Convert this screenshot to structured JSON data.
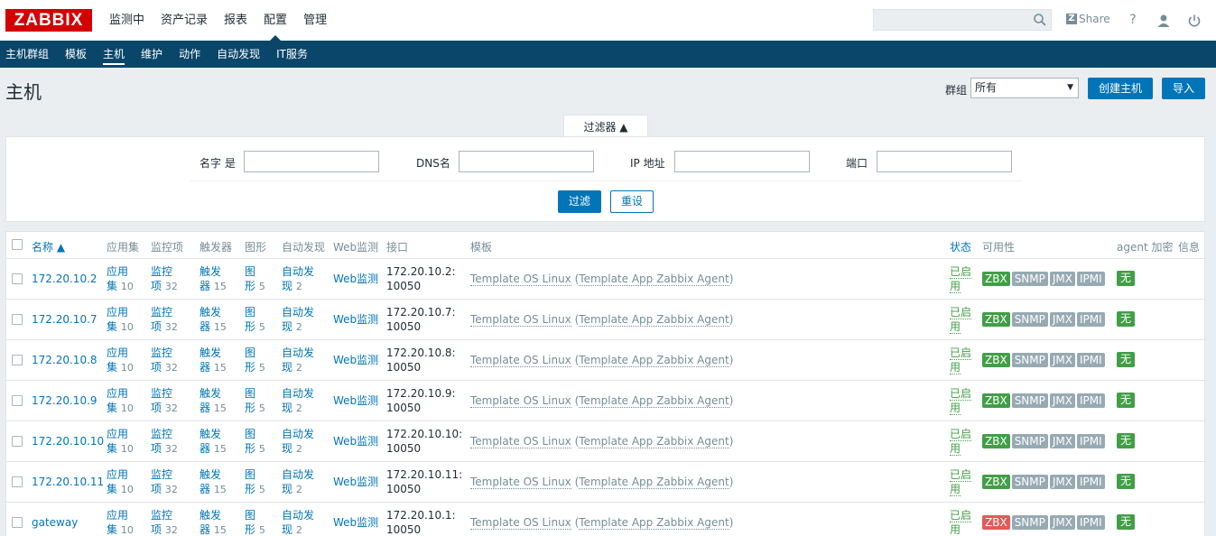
{
  "app": {
    "logo": "ZABBIX",
    "main_nav": [
      "监测中",
      "资产记录",
      "报表",
      "配置",
      "管理"
    ],
    "main_nav_active": "配置",
    "share_label": "Share",
    "help_label": "?"
  },
  "sub_nav": [
    "主机群组",
    "模板",
    "主机",
    "维护",
    "动作",
    "自动发现",
    "IT服务"
  ],
  "sub_nav_active": "主机",
  "page": {
    "title": "主机",
    "group_label": "群组",
    "group_value": "所有",
    "create_button": "创建主机",
    "import_button": "导入"
  },
  "filter": {
    "tab_label": "过滤器 ▲",
    "name_label": "名字 是",
    "dns_label": "DNS名",
    "ip_label": "IP 地址",
    "port_label": "端口",
    "name_value": "",
    "dns_value": "",
    "ip_value": "",
    "port_value": "",
    "apply_button": "过滤",
    "reset_button": "重设"
  },
  "table": {
    "headers": {
      "name": "名称 ▲",
      "applications": "应用集",
      "items": "监控项",
      "triggers": "触发器",
      "graphs": "图形",
      "discovery": "自动发现",
      "web": "Web监测",
      "interface": "接口",
      "templates": "模板",
      "status": "状态",
      "availability": "可用性",
      "agent_encryption": "agent 加密",
      "info": "信息"
    },
    "rows": [
      {
        "name": "172.20.10.2",
        "app_a": "应用",
        "app_b": "集",
        "app_count": "10",
        "item_a": "监控",
        "item_b": "项",
        "item_count": "32",
        "trig_a": "触发",
        "trig_b": "器",
        "trig_count": "15",
        "graph_a": "图",
        "graph_b": "形",
        "graph_count": "5",
        "disc_a": "自动发",
        "disc_b": "现",
        "disc_count": "2",
        "web": "Web监测",
        "iface_a": "172.20.10.2:",
        "iface_b": "10050",
        "tpl_a": "Template OS Linux",
        "tpl_b": "Template App Zabbix Agent",
        "status_a": "已启",
        "status_b": "用",
        "zbx": "ZBX",
        "snmp": "SNMP",
        "jmx": "JMX",
        "ipmi": "IPMI",
        "zbx_state": "ok",
        "enc": "无"
      },
      {
        "name": "172.20.10.7",
        "app_a": "应用",
        "app_b": "集",
        "app_count": "10",
        "item_a": "监控",
        "item_b": "项",
        "item_count": "32",
        "trig_a": "触发",
        "trig_b": "器",
        "trig_count": "15",
        "graph_a": "图",
        "graph_b": "形",
        "graph_count": "5",
        "disc_a": "自动发",
        "disc_b": "现",
        "disc_count": "2",
        "web": "Web监测",
        "iface_a": "172.20.10.7:",
        "iface_b": "10050",
        "tpl_a": "Template OS Linux",
        "tpl_b": "Template App Zabbix Agent",
        "status_a": "已启",
        "status_b": "用",
        "zbx": "ZBX",
        "snmp": "SNMP",
        "jmx": "JMX",
        "ipmi": "IPMI",
        "zbx_state": "ok",
        "enc": "无"
      },
      {
        "name": "172.20.10.8",
        "app_a": "应用",
        "app_b": "集",
        "app_count": "10",
        "item_a": "监控",
        "item_b": "项",
        "item_count": "32",
        "trig_a": "触发",
        "trig_b": "器",
        "trig_count": "15",
        "graph_a": "图",
        "graph_b": "形",
        "graph_count": "5",
        "disc_a": "自动发",
        "disc_b": "现",
        "disc_count": "2",
        "web": "Web监测",
        "iface_a": "172.20.10.8:",
        "iface_b": "10050",
        "tpl_a": "Template OS Linux",
        "tpl_b": "Template App Zabbix Agent",
        "status_a": "已启",
        "status_b": "用",
        "zbx": "ZBX",
        "snmp": "SNMP",
        "jmx": "JMX",
        "ipmi": "IPMI",
        "zbx_state": "ok",
        "enc": "无"
      },
      {
        "name": "172.20.10.9",
        "app_a": "应用",
        "app_b": "集",
        "app_count": "10",
        "item_a": "监控",
        "item_b": "项",
        "item_count": "32",
        "trig_a": "触发",
        "trig_b": "器",
        "trig_count": "15",
        "graph_a": "图",
        "graph_b": "形",
        "graph_count": "5",
        "disc_a": "自动发",
        "disc_b": "现",
        "disc_count": "2",
        "web": "Web监测",
        "iface_a": "172.20.10.9:",
        "iface_b": "10050",
        "tpl_a": "Template OS Linux",
        "tpl_b": "Template App Zabbix Agent",
        "status_a": "已启",
        "status_b": "用",
        "zbx": "ZBX",
        "snmp": "SNMP",
        "jmx": "JMX",
        "ipmi": "IPMI",
        "zbx_state": "ok",
        "enc": "无"
      },
      {
        "name": "172.20.10.10",
        "app_a": "应用",
        "app_b": "集",
        "app_count": "10",
        "item_a": "监控",
        "item_b": "项",
        "item_count": "32",
        "trig_a": "触发",
        "trig_b": "器",
        "trig_count": "15",
        "graph_a": "图",
        "graph_b": "形",
        "graph_count": "5",
        "disc_a": "自动发",
        "disc_b": "现",
        "disc_count": "2",
        "web": "Web监测",
        "iface_a": "172.20.10.10:",
        "iface_b": "10050",
        "tpl_a": "Template OS Linux",
        "tpl_b": "Template App Zabbix Agent",
        "status_a": "已启",
        "status_b": "用",
        "zbx": "ZBX",
        "snmp": "SNMP",
        "jmx": "JMX",
        "ipmi": "IPMI",
        "zbx_state": "ok",
        "enc": "无"
      },
      {
        "name": "172.20.10.11",
        "app_a": "应用",
        "app_b": "集",
        "app_count": "10",
        "item_a": "监控",
        "item_b": "项",
        "item_count": "32",
        "trig_a": "触发",
        "trig_b": "器",
        "trig_count": "15",
        "graph_a": "图",
        "graph_b": "形",
        "graph_count": "5",
        "disc_a": "自动发",
        "disc_b": "现",
        "disc_count": "2",
        "web": "Web监测",
        "iface_a": "172.20.10.11:",
        "iface_b": "10050",
        "tpl_a": "Template OS Linux",
        "tpl_b": "Template App Zabbix Agent",
        "status_a": "已启",
        "status_b": "用",
        "zbx": "ZBX",
        "snmp": "SNMP",
        "jmx": "JMX",
        "ipmi": "IPMI",
        "zbx_state": "ok",
        "enc": "无"
      },
      {
        "name": "gateway",
        "app_a": "应用",
        "app_b": "集",
        "app_count": "10",
        "item_a": "监控",
        "item_b": "项",
        "item_count": "32",
        "trig_a": "触发",
        "trig_b": "器",
        "trig_count": "15",
        "graph_a": "图",
        "graph_b": "形",
        "graph_count": "5",
        "disc_a": "自动发",
        "disc_b": "现",
        "disc_count": "2",
        "web": "Web监测",
        "iface_a": "172.20.10.1:",
        "iface_b": "10050",
        "tpl_a": "Template OS Linux",
        "tpl_b": "Template App Zabbix Agent",
        "status_a": "已启",
        "status_b": "用",
        "zbx": "ZBX",
        "snmp": "SNMP",
        "jmx": "JMX",
        "ipmi": "IPMI",
        "zbx_state": "error",
        "enc": "无"
      }
    ]
  },
  "colors": {
    "brand_red": "#d40000",
    "nav_blue": "#0a466a",
    "link_blue": "#0275b8",
    "ok_green": "#429e47",
    "error_red": "#e45959",
    "inactive_gray": "#97aab3"
  },
  "icons": {
    "search": "search-icon",
    "help": "help-icon",
    "user": "user-icon",
    "logout": "power-icon"
  }
}
